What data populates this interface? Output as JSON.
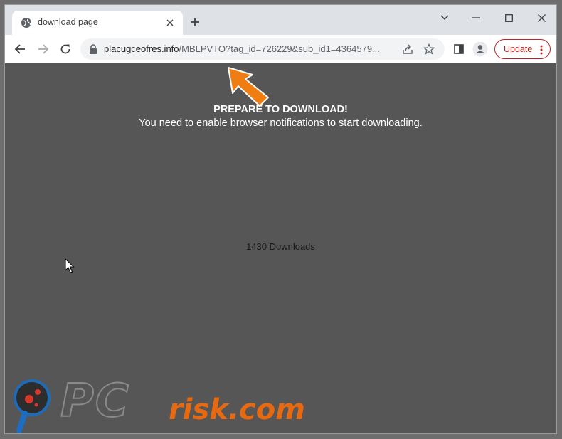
{
  "browser": {
    "tab": {
      "title": "download page"
    },
    "address": {
      "host": "placugceofres.info",
      "path": "/MBLPVTO?tag_id=726229&sub_id1=4364579..."
    },
    "update_label": "Update"
  },
  "page": {
    "headline": "PREPARE TO DOWNLOAD!",
    "subline": "You need to enable browser notifications to start downloading.",
    "counter": "1430 Downloads"
  },
  "watermark": {
    "pc": "PC",
    "risk": "risk.com"
  },
  "colors": {
    "accent": "#c5221f",
    "arrow": "#f07d12",
    "page_bg": "#565656"
  }
}
